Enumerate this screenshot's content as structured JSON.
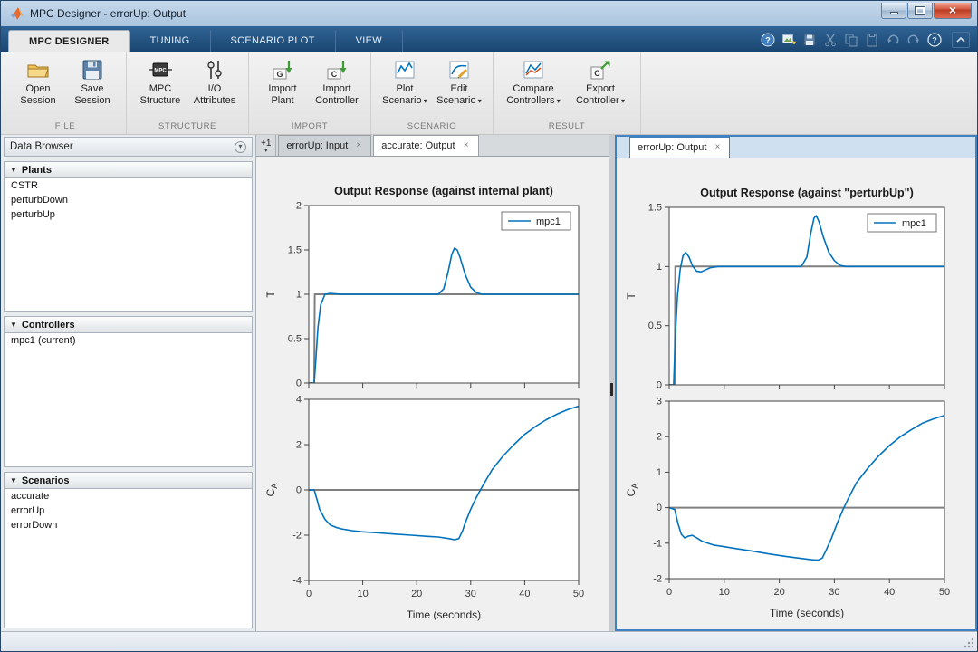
{
  "window": {
    "title": "MPC Designer - errorUp: Output"
  },
  "ribbon": {
    "tabs": [
      {
        "label": "MPC DESIGNER",
        "active": true
      },
      {
        "label": "TUNING",
        "active": false
      },
      {
        "label": "SCENARIO PLOT",
        "active": false
      },
      {
        "label": "VIEW",
        "active": false
      }
    ],
    "groups": [
      {
        "name": "FILE",
        "buttons": [
          {
            "label": "Open Session"
          },
          {
            "label": "Save Session"
          }
        ]
      },
      {
        "name": "STRUCTURE",
        "buttons": [
          {
            "label": "MPC Structure"
          },
          {
            "label": "I/O Attributes"
          }
        ]
      },
      {
        "name": "IMPORT",
        "buttons": [
          {
            "label": "Import Plant"
          },
          {
            "label": "Import Controller"
          }
        ]
      },
      {
        "name": "SCENARIO",
        "buttons": [
          {
            "label": "Plot Scenario",
            "dropdown": true
          },
          {
            "label": "Edit Scenario",
            "dropdown": true
          }
        ]
      },
      {
        "name": "RESULT",
        "buttons": [
          {
            "label": "Compare Controllers",
            "dropdown": true
          },
          {
            "label": "Export Controller",
            "dropdown": true
          }
        ]
      }
    ]
  },
  "data_browser": {
    "title": "Data Browser",
    "sections": [
      {
        "title": "Plants",
        "items": [
          "CSTR",
          "perturbDown",
          "perturbUp"
        ]
      },
      {
        "title": "Controllers",
        "items": [
          "mpc1 (current)"
        ]
      },
      {
        "title": "Scenarios",
        "items": [
          "accurate",
          "errorUp",
          "errorDown"
        ]
      }
    ]
  },
  "documents": {
    "left": {
      "overflow": "+1",
      "tabs": [
        {
          "label": "errorUp: Input",
          "active": false
        },
        {
          "label": "accurate: Output",
          "active": true
        }
      ]
    },
    "right": {
      "tabs": [
        {
          "label": "errorUp: Output",
          "active": true
        }
      ]
    }
  },
  "colors": {
    "mpc_line": "#0072BD",
    "reference_line": "#808080",
    "focus_border": "#3f81c1"
  },
  "chart_data": [
    {
      "type": "line",
      "title": "Output Response (against internal plant)",
      "ylabel": "T",
      "xlim": [
        0,
        50
      ],
      "ylim": [
        0,
        2
      ],
      "xticks": [
        0,
        10,
        20,
        30,
        40,
        50
      ],
      "show_x_labels": false,
      "yticks": [
        0,
        0.5,
        1,
        1.5,
        2
      ],
      "legend": [
        {
          "label": "mpc1",
          "color": "#0072BD"
        }
      ],
      "series": [
        {
          "name": "reference",
          "color": "#808080",
          "width": 2,
          "points": [
            [
              0,
              0
            ],
            [
              1,
              0
            ],
            [
              1.1,
              1
            ],
            [
              50,
              1
            ]
          ]
        },
        {
          "name": "mpc1",
          "color": "#0072BD",
          "width": 1.6,
          "points": [
            [
              0,
              0
            ],
            [
              1,
              0
            ],
            [
              1.3,
              0.25
            ],
            [
              1.7,
              0.62
            ],
            [
              2.2,
              0.88
            ],
            [
              3,
              1
            ],
            [
              4,
              1.01
            ],
            [
              6,
              1
            ],
            [
              10,
              1
            ],
            [
              15,
              1
            ],
            [
              20,
              1
            ],
            [
              24,
              1
            ],
            [
              25,
              1.06
            ],
            [
              25.8,
              1.25
            ],
            [
              26.5,
              1.45
            ],
            [
              27,
              1.52
            ],
            [
              27.5,
              1.5
            ],
            [
              28,
              1.42
            ],
            [
              29,
              1.22
            ],
            [
              30,
              1.08
            ],
            [
              31,
              1.02
            ],
            [
              32,
              1
            ],
            [
              35,
              1
            ],
            [
              40,
              1
            ],
            [
              45,
              1
            ],
            [
              50,
              1
            ]
          ]
        }
      ]
    },
    {
      "type": "line",
      "ylabel": "C_A",
      "xlabel": "Time (seconds)",
      "xlim": [
        0,
        50
      ],
      "ylim": [
        -4,
        4
      ],
      "xticks": [
        0,
        10,
        20,
        30,
        40,
        50
      ],
      "show_x_labels": true,
      "yticks": [
        -4,
        -2,
        0,
        2,
        4
      ],
      "series": [
        {
          "name": "reference",
          "color": "#808080",
          "width": 2,
          "points": [
            [
              0,
              0
            ],
            [
              50,
              0
            ]
          ]
        },
        {
          "name": "mpc1",
          "color": "#0072BD",
          "width": 1.6,
          "points": [
            [
              0,
              0
            ],
            [
              1,
              0
            ],
            [
              1.5,
              -0.4
            ],
            [
              2,
              -0.85
            ],
            [
              3,
              -1.3
            ],
            [
              4,
              -1.55
            ],
            [
              5,
              -1.65
            ],
            [
              6,
              -1.72
            ],
            [
              8,
              -1.8
            ],
            [
              10,
              -1.85
            ],
            [
              13,
              -1.9
            ],
            [
              16,
              -1.95
            ],
            [
              19,
              -2
            ],
            [
              22,
              -2.05
            ],
            [
              24,
              -2.08
            ],
            [
              26,
              -2.15
            ],
            [
              27,
              -2.2
            ],
            [
              27.8,
              -2.15
            ],
            [
              28.5,
              -1.8
            ],
            [
              29,
              -1.45
            ],
            [
              30,
              -0.85
            ],
            [
              31,
              -0.35
            ],
            [
              31.8,
              0
            ],
            [
              33,
              0.5
            ],
            [
              34,
              0.9
            ],
            [
              36,
              1.5
            ],
            [
              38,
              2
            ],
            [
              40,
              2.45
            ],
            [
              42,
              2.8
            ],
            [
              44,
              3.1
            ],
            [
              46,
              3.35
            ],
            [
              48,
              3.55
            ],
            [
              50,
              3.7
            ]
          ]
        }
      ]
    },
    {
      "type": "line",
      "title": "Output Response (against \"perturbUp\")",
      "ylabel": "T",
      "xlim": [
        0,
        50
      ],
      "ylim": [
        0,
        1.5
      ],
      "xticks": [
        0,
        10,
        20,
        30,
        40,
        50
      ],
      "show_x_labels": false,
      "yticks": [
        0,
        0.5,
        1,
        1.5
      ],
      "legend": [
        {
          "label": "mpc1",
          "color": "#0072BD"
        }
      ],
      "series": [
        {
          "name": "reference",
          "color": "#808080",
          "width": 2,
          "points": [
            [
              0,
              0
            ],
            [
              1,
              0
            ],
            [
              1.1,
              1
            ],
            [
              50,
              1
            ]
          ]
        },
        {
          "name": "mpc1",
          "color": "#0072BD",
          "width": 1.6,
          "points": [
            [
              0,
              0
            ],
            [
              0.8,
              0
            ],
            [
              1.1,
              0.4
            ],
            [
              1.5,
              0.75
            ],
            [
              2,
              0.98
            ],
            [
              2.5,
              1.09
            ],
            [
              3,
              1.12
            ],
            [
              3.6,
              1.08
            ],
            [
              4.3,
              1
            ],
            [
              5,
              0.96
            ],
            [
              5.8,
              0.955
            ],
            [
              6.5,
              0.97
            ],
            [
              7.5,
              0.99
            ],
            [
              9,
              1
            ],
            [
              12,
              1
            ],
            [
              16,
              1
            ],
            [
              20,
              1
            ],
            [
              24,
              1
            ],
            [
              25,
              1.08
            ],
            [
              25.7,
              1.28
            ],
            [
              26.3,
              1.41
            ],
            [
              26.7,
              1.43
            ],
            [
              27.2,
              1.38
            ],
            [
              28,
              1.25
            ],
            [
              29,
              1.12
            ],
            [
              30,
              1.05
            ],
            [
              31,
              1.01
            ],
            [
              32,
              1
            ],
            [
              36,
              1
            ],
            [
              40,
              1
            ],
            [
              45,
              1
            ],
            [
              50,
              1
            ]
          ]
        }
      ]
    },
    {
      "type": "line",
      "ylabel": "C_A",
      "xlabel": "Time (seconds)",
      "xlim": [
        0,
        50
      ],
      "ylim": [
        -2,
        3
      ],
      "xticks": [
        0,
        10,
        20,
        30,
        40,
        50
      ],
      "show_x_labels": true,
      "yticks": [
        -2,
        -1,
        0,
        1,
        2,
        3
      ],
      "series": [
        {
          "name": "reference",
          "color": "#808080",
          "width": 2,
          "points": [
            [
              0,
              0
            ],
            [
              50,
              0
            ]
          ]
        },
        {
          "name": "mpc1",
          "color": "#0072BD",
          "width": 1.6,
          "points": [
            [
              0,
              0
            ],
            [
              1,
              -0.05
            ],
            [
              1.6,
              -0.45
            ],
            [
              2.2,
              -0.75
            ],
            [
              2.8,
              -0.85
            ],
            [
              3.5,
              -0.8
            ],
            [
              4.2,
              -0.78
            ],
            [
              5,
              -0.85
            ],
            [
              6,
              -0.95
            ],
            [
              7,
              -1
            ],
            [
              8,
              -1.05
            ],
            [
              10,
              -1.1
            ],
            [
              12,
              -1.15
            ],
            [
              15,
              -1.22
            ],
            [
              18,
              -1.3
            ],
            [
              21,
              -1.37
            ],
            [
              24,
              -1.43
            ],
            [
              26,
              -1.47
            ],
            [
              27,
              -1.48
            ],
            [
              27.8,
              -1.42
            ],
            [
              28.5,
              -1.2
            ],
            [
              29.5,
              -0.85
            ],
            [
              30.5,
              -0.45
            ],
            [
              31.5,
              -0.08
            ],
            [
              32.5,
              0.25
            ],
            [
              34,
              0.7
            ],
            [
              36,
              1.1
            ],
            [
              38,
              1.45
            ],
            [
              40,
              1.75
            ],
            [
              42,
              2
            ],
            [
              44,
              2.2
            ],
            [
              46,
              2.38
            ],
            [
              48,
              2.5
            ],
            [
              50,
              2.6
            ]
          ]
        }
      ]
    }
  ]
}
